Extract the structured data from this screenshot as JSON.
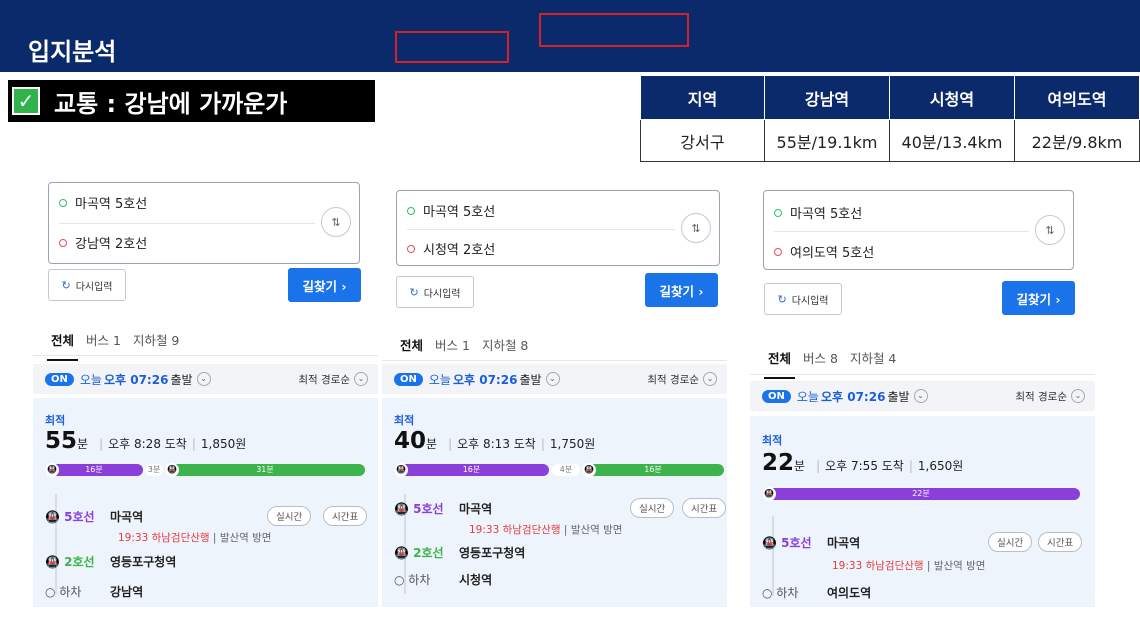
{
  "header": {
    "title": "입지분석"
  },
  "section": {
    "title": "교통 : 강남에 가까운가"
  },
  "distance_table": {
    "headers": [
      "지역",
      "강남역",
      "시청역",
      "여의도역"
    ],
    "row": [
      "강서구",
      "55분/19.1km",
      "40분/13.4km",
      "22분/9.8km"
    ]
  },
  "common": {
    "reset": "다시입력",
    "search": "길찾기 ›",
    "swap": "⇅",
    "today": "오늘",
    "time": "오후 07:26",
    "depart": "출발",
    "sort": "최적 경로순",
    "best": "최적",
    "min_unit": "분",
    "on_badge": "ON",
    "realtime": "실시간",
    "timetable": "시간표",
    "dropdown": "⌄"
  },
  "panels": [
    {
      "start": "마곡역 5호선",
      "end": "강남역 2호선",
      "tabs": [
        "전체",
        "버스 1",
        "지하철 9"
      ],
      "minutes": "55",
      "arrival": "오후 8:28 도착",
      "fare": "1,850원",
      "bar": [
        "16분",
        "3분",
        "31분"
      ],
      "steps": [
        {
          "line": "5호선",
          "station": "마곡역"
        },
        {
          "line": "2호선",
          "station": "영등포구청역"
        },
        {
          "line": "하차",
          "station": "강남역"
        }
      ],
      "train_time": "19:33",
      "train_info": "하남검단산행",
      "train_dir": "발산역 방면"
    },
    {
      "start": "마곡역 5호선",
      "end": "시청역 2호선",
      "tabs": [
        "전체",
        "버스 1",
        "지하철 8"
      ],
      "minutes": "40",
      "arrival": "오후 8:13 도착",
      "fare": "1,750원",
      "bar": [
        "16분",
        "4분",
        "16분"
      ],
      "steps": [
        {
          "line": "5호선",
          "station": "마곡역"
        },
        {
          "line": "2호선",
          "station": "영등포구청역"
        },
        {
          "line": "하차",
          "station": "시청역"
        }
      ],
      "train_time": "19:33",
      "train_info": "하남검단산행",
      "train_dir": "발산역 방면"
    },
    {
      "start": "마곡역 5호선",
      "end": "여의도역 5호선",
      "tabs": [
        "전체",
        "버스 8",
        "지하철 4"
      ],
      "minutes": "22",
      "arrival": "오후 7:55 도착",
      "fare": "1,650원",
      "bar": [
        "22분"
      ],
      "steps": [
        {
          "line": "5호선",
          "station": "마곡역"
        },
        {
          "line": "하차",
          "station": "여의도역"
        }
      ],
      "train_time": "19:33",
      "train_info": "하남검단산행",
      "train_dir": "발산역 방면"
    }
  ],
  "colors": {
    "header": "#0b2a6b",
    "accent": "#1a73e8",
    "line5": "#8b3fd9",
    "line2": "#3cb44b",
    "highlight": "#d4202a"
  }
}
